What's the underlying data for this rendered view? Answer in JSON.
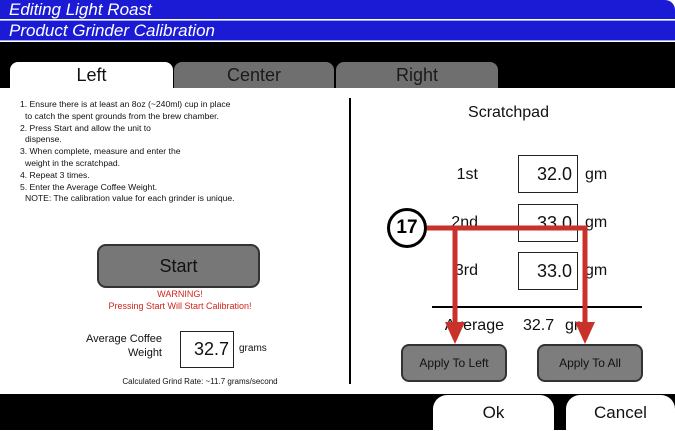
{
  "window": {
    "title": "Editing Light Roast",
    "subtitle": "Product Grinder Calibration"
  },
  "tabs": [
    {
      "label": "Left",
      "active": true
    },
    {
      "label": "Center",
      "active": false
    },
    {
      "label": "Right",
      "active": false
    }
  ],
  "left_panel": {
    "instructions": [
      "1. Ensure there is at least an 8oz (~240ml) cup in place",
      "    to catch the spent grounds from the brew chamber.",
      "2. Press Start and allow the unit to",
      "    dispense.",
      "3. When complete, measure and enter the",
      "    weight in the scratchpad.",
      "4. Repeat 3 times.",
      "5. Enter the Average Coffee Weight.",
      "    NOTE:  The calibration value for each grinder is unique."
    ],
    "start_label": "Start",
    "warning_title": "WARNING!",
    "warning_text": "Pressing Start Will Start Calibration!",
    "avg_label_line1": "Average Coffee",
    "avg_label_line2": "Weight",
    "avg_value": "32.7",
    "avg_unit": "grams",
    "calc_rate": "Calculated Grind Rate: ~11.7 grams/second"
  },
  "scratchpad": {
    "title": "Scratchpad",
    "rows": [
      {
        "label": "1st",
        "value": "32.0",
        "unit": "gm"
      },
      {
        "label": "2nd",
        "value": "33.0",
        "unit": "gm"
      },
      {
        "label": "3rd",
        "value": "33.0",
        "unit": "gm"
      }
    ],
    "average_label": "Average",
    "average_value": "32.7",
    "average_unit": "gm",
    "apply_left_label": "Apply To Left",
    "apply_all_label": "Apply To All"
  },
  "footer": {
    "ok_label": "Ok",
    "cancel_label": "Cancel"
  },
  "annotation": {
    "callout_number": "17",
    "color": "#c8322b"
  },
  "colors": {
    "titlebar": "#1b1bd6",
    "warning": "#d0261c"
  }
}
